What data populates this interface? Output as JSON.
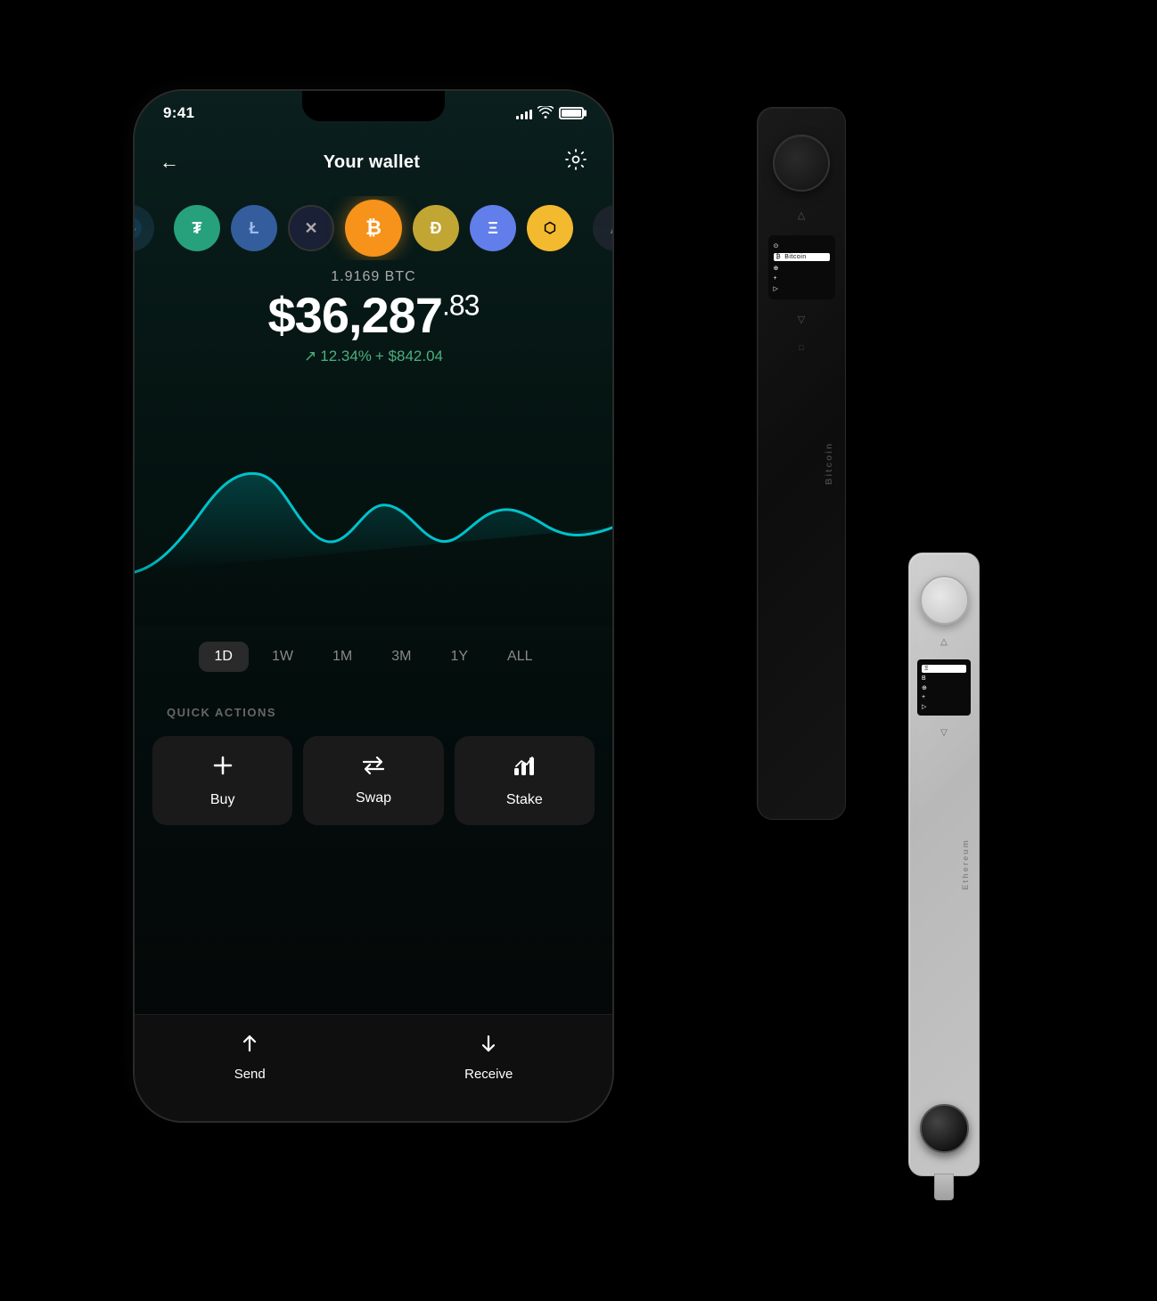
{
  "status_bar": {
    "time": "9:41",
    "signal": [
      3,
      5,
      8,
      11,
      14
    ],
    "battery": 100
  },
  "header": {
    "back_label": "←",
    "title": "Your wallet",
    "settings_symbol": "⚙"
  },
  "coins": [
    {
      "id": "unknown",
      "symbol": "?",
      "bg": "#1a3a4a",
      "color": "#4a9ab5",
      "partial": true
    },
    {
      "id": "tether",
      "symbol": "₮",
      "bg": "#26a17b",
      "color": "#fff"
    },
    {
      "id": "litecoin",
      "symbol": "Ł",
      "bg": "#345d9d",
      "color": "#9dbaed"
    },
    {
      "id": "xrp",
      "symbol": "✕",
      "bg": "#1a2035",
      "color": "#aaa"
    },
    {
      "id": "bitcoin",
      "symbol": "₿",
      "bg": "#f7931a",
      "color": "#fff",
      "selected": true
    },
    {
      "id": "dogecoin",
      "symbol": "Ð",
      "bg": "#c2a633",
      "color": "#fff"
    },
    {
      "id": "ethereum",
      "symbol": "Ξ",
      "bg": "#627eea",
      "color": "#fff"
    },
    {
      "id": "binance",
      "symbol": "B",
      "bg": "#f3ba2f",
      "color": "#000"
    },
    {
      "id": "algo",
      "symbol": "A",
      "bg": "#2a2a3a",
      "color": "#aaa",
      "partial": true
    }
  ],
  "balance": {
    "crypto_amount": "1.9169 BTC",
    "usd_main": "$36,287",
    "usd_cents": ".83",
    "change_pct": "12.34%",
    "change_usd": "+ $842.04",
    "change_arrow": "↗"
  },
  "chart": {
    "color": "#00c2cb",
    "periods": [
      "1D",
      "1W",
      "1M",
      "3M",
      "1Y",
      "ALL"
    ],
    "active_period": "1D"
  },
  "quick_actions": {
    "label": "QUICK ACTIONS",
    "buttons": [
      {
        "id": "buy",
        "icon": "+",
        "label": "Buy"
      },
      {
        "id": "swap",
        "icon": "⇄",
        "label": "Swap"
      },
      {
        "id": "stake",
        "icon": "📊",
        "label": "Stake"
      }
    ]
  },
  "bottom_nav": {
    "buttons": [
      {
        "id": "send",
        "icon": "↑",
        "label": "Send"
      },
      {
        "id": "receive",
        "icon": "↓",
        "label": "Receive"
      }
    ]
  },
  "ledger_nano_x": {
    "label": "Bitcoin",
    "menu_items": [
      {
        "icon": "△",
        "label": ""
      },
      {
        "icon": "⊙",
        "label": ""
      },
      {
        "icon": "₿",
        "label": "Bitcoin",
        "selected": true
      },
      {
        "icon": "⊕",
        "label": ""
      },
      {
        "icon": "⊞",
        "label": ""
      },
      {
        "icon": "+",
        "label": ""
      },
      {
        "icon": "▷",
        "label": ""
      },
      {
        "icon": "▽",
        "label": ""
      },
      {
        "icon": "□",
        "label": ""
      }
    ]
  },
  "ledger_nano_s": {
    "label": "Ethereum",
    "menu_items": [
      {
        "icon": "△",
        "label": ""
      },
      {
        "icon": "Ξ",
        "label": "",
        "selected": true
      },
      {
        "icon": "B",
        "label": ""
      },
      {
        "icon": "⊕",
        "label": ""
      },
      {
        "icon": "⊞",
        "label": ""
      },
      {
        "icon": "+",
        "label": ""
      },
      {
        "icon": "▷",
        "label": ""
      },
      {
        "icon": "▽",
        "label": ""
      }
    ]
  }
}
